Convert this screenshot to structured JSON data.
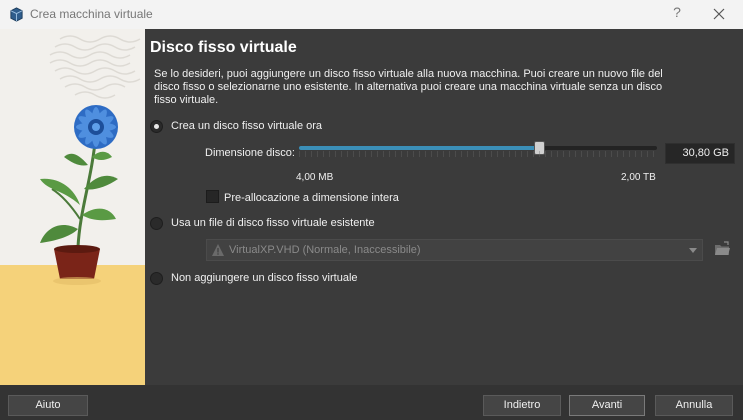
{
  "window": {
    "title": "Crea macchina virtuale",
    "help_label": "?"
  },
  "page": {
    "title": "Disco fisso virtuale",
    "description": "Se lo desideri, puoi aggiungere un disco fisso virtuale alla nuova macchina. Puoi creare un nuovo file del disco fisso o selezionarne uno esistente. In alternativa puoi creare una macchina virtuale senza un disco fisso virtuale."
  },
  "options": {
    "create_new": {
      "label": "Crea un disco fisso virtuale ora",
      "selected": true
    },
    "use_existing": {
      "label": "Usa un file di disco fisso virtuale esistente",
      "selected": false
    },
    "no_disk": {
      "label": "Non aggiungere un disco fisso virtuale",
      "selected": false
    }
  },
  "disk_size": {
    "label": "Dimensione disco:",
    "value": "30,80 GB",
    "min_label": "4,00 MB",
    "max_label": "2,00 TB",
    "slider_fraction": 0.67
  },
  "preallocate": {
    "label": "Pre-allocazione a dimensione intera",
    "checked": false
  },
  "existing_file": {
    "selected": "VirtualXP.VHD (Normale, Inaccessibile)",
    "icon": "warning-icon"
  },
  "buttons": {
    "help": "Aiuto",
    "back": "Indietro",
    "next": "Avanti",
    "cancel": "Annulla"
  },
  "colors": {
    "accent": "#3b8fb8",
    "background": "#3b3b3b",
    "titlebar": "#f3f3f3"
  }
}
